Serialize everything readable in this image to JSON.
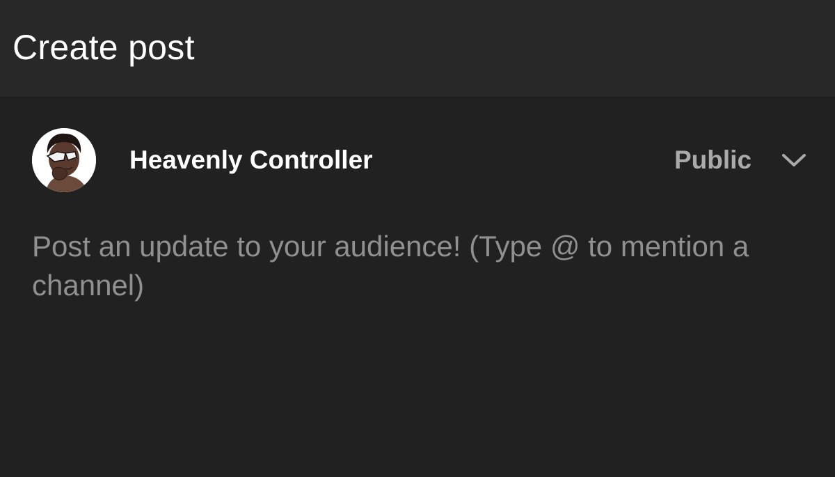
{
  "header": {
    "title": "Create post"
  },
  "author": {
    "channel_name": "Heavenly Controller",
    "avatar_icon": "avatar-icon"
  },
  "visibility": {
    "selected": "Public",
    "icon": "chevron-down-icon"
  },
  "composer": {
    "value": "",
    "placeholder": "Post an update to your audience! (Type @ to mention a channel)"
  },
  "colors": {
    "background": "#212121",
    "header_background": "#282828",
    "primary_text": "#ffffff",
    "secondary_text": "#aaaaaa",
    "placeholder_text": "#909090"
  }
}
